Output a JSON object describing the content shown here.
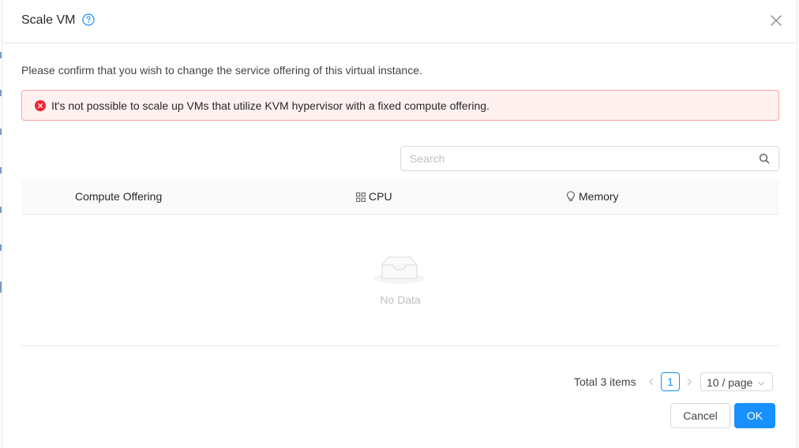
{
  "modal": {
    "title": "Scale VM",
    "help_icon": "question-circle-icon",
    "close_icon": "close-icon"
  },
  "confirm_text": "Please confirm that you wish to change the service offering of this virtual instance.",
  "alert": {
    "type": "error",
    "icon": "close-circle-icon",
    "message": "It's not possible to scale up VMs that utilize KVM hypervisor with a fixed compute offering."
  },
  "search": {
    "placeholder": "Search",
    "value": "",
    "icon": "search-icon"
  },
  "table": {
    "columns": [
      {
        "label": "Compute Offering",
        "icon": ""
      },
      {
        "label": "CPU",
        "icon": "appstore-icon"
      },
      {
        "label": "Memory",
        "icon": "bulb-icon"
      }
    ],
    "rows": [],
    "empty_text": "No Data"
  },
  "pagination": {
    "total_text": "Total 3 items",
    "current_page": "1",
    "page_size": "10 / page"
  },
  "footer": {
    "cancel_label": "Cancel",
    "ok_label": "OK"
  },
  "colors": {
    "primary": "#1890ff",
    "error": "#f5222d",
    "error_bg": "#fff1f0",
    "error_border": "#ffa39e"
  }
}
